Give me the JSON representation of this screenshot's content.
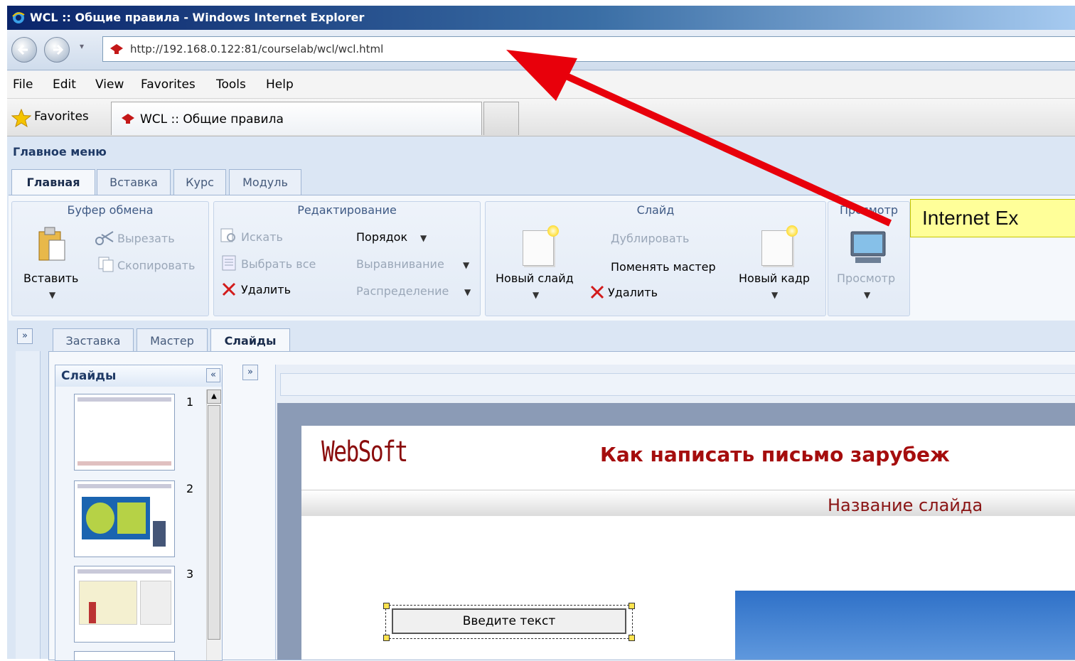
{
  "window": {
    "title": "WCL :: Общие правила - Windows Internet Explorer",
    "url": "http://192.168.0.122:81/courselab/wcl/wcl.html"
  },
  "menubar": [
    "File",
    "Edit",
    "View",
    "Favorites",
    "Tools",
    "Help"
  ],
  "favbar": {
    "favorites_label": "Favorites",
    "tab_title": "WCL :: Общие правила"
  },
  "app": {
    "main_menu_title": "Главное меню",
    "ribbon_tabs": [
      "Главная",
      "Вставка",
      "Курс",
      "Модуль"
    ],
    "active_ribbon_tab": "Главная",
    "groups": {
      "clipboard": {
        "title": "Буфер обмена",
        "paste": "Вставить",
        "cut": "Вырезать",
        "copy": "Скопировать"
      },
      "editing": {
        "title": "Редактирование",
        "find": "Искать",
        "select_all": "Выбрать все",
        "delete": "Удалить",
        "order": "Порядок",
        "align": "Выравнивание",
        "distribute": "Распределение"
      },
      "slide": {
        "title": "Слайд",
        "new_slide": "Новый слайд",
        "duplicate": "Дублировать",
        "change_master": "Поменять мастер",
        "delete": "Удалить",
        "new_frame": "Новый кадр"
      },
      "view": {
        "title": "Просмотр",
        "preview": "Просмотр"
      }
    },
    "sub_tabs": [
      "Заставка",
      "Мастер",
      "Слайды"
    ],
    "active_sub_tab": "Слайды",
    "slides_panel": {
      "title": "Слайды",
      "slide_numbers": [
        "1",
        "2",
        "3"
      ]
    },
    "slide": {
      "logo": "WebSoft",
      "heading": "Как написать письмо зарубеж",
      "slide_name": "Название слайда",
      "textbox": "Введите текст"
    }
  },
  "annotation": {
    "callout_text": "Internet Ex",
    "arrow_color": "#e8000b",
    "callout_color": "#ffff99"
  }
}
